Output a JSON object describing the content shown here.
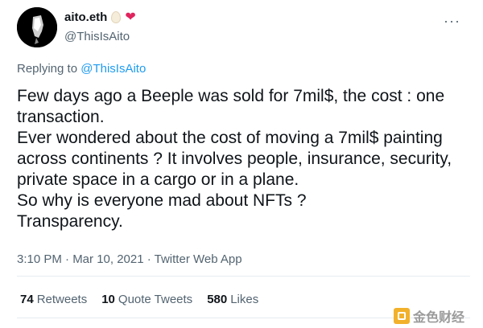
{
  "author": {
    "display_name": "aito.eth",
    "handle": "@ThisIsAito",
    "badges": [
      "egg-emoji",
      "heart-emoji"
    ]
  },
  "reply": {
    "prefix": "Replying to",
    "target": "@ThisIsAito"
  },
  "tweet": {
    "lines": [
      "Few days ago a Beeple was sold for 7mil$, the cost : one transaction.",
      "Ever wondered about the cost of moving a 7mil$ painting across continents ? It involves people, insurance, security, private space in a cargo or in a plane.",
      "So why is everyone mad about NFTs ?",
      "Transparency."
    ],
    "meta": "3:10 PM · Mar 10, 2021 · Twitter Web App"
  },
  "stats": {
    "retweets_count": "74",
    "retweets_label": "Retweets",
    "quotes_count": "10",
    "quotes_label": "Quote Tweets",
    "likes_count": "580",
    "likes_label": "Likes"
  },
  "watermark": {
    "text": "金色财经"
  },
  "colors": {
    "link": "#1d9bf0",
    "muted": "#536471",
    "heart": "#e0245e"
  }
}
